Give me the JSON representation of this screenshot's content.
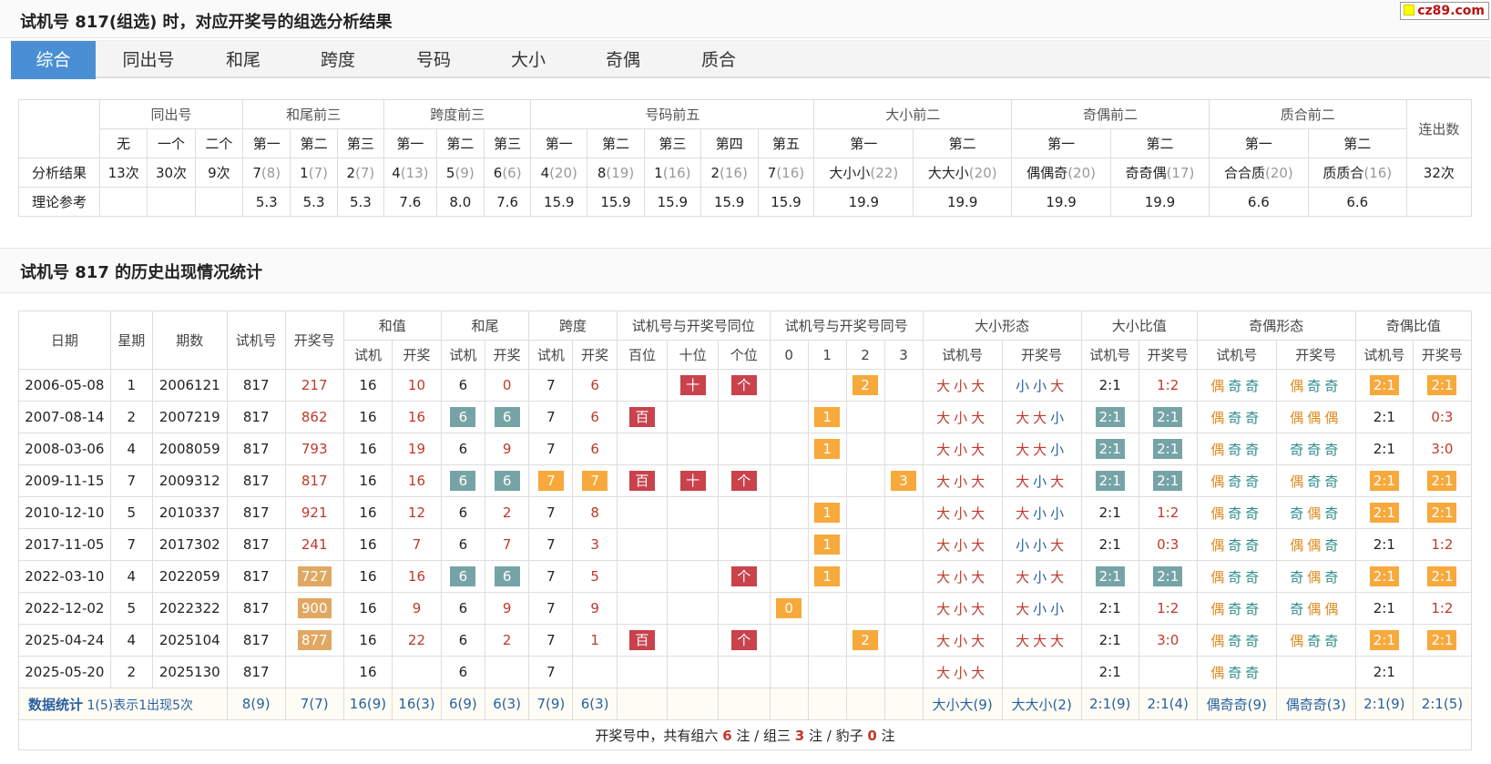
{
  "page_title": "试机号 817(组选) 时，对应开奖号的组选分析结果",
  "logo": "cz89.com",
  "tabs": [
    "综合",
    "同出号",
    "和尾",
    "跨度",
    "号码",
    "大小",
    "奇偶",
    "质合"
  ],
  "analysis": {
    "groups": [
      "同出号",
      "和尾前三",
      "跨度前三",
      "号码前五",
      "大小前二",
      "奇偶前二",
      "质合前二",
      "连出数"
    ],
    "subs": [
      "无",
      "一个",
      "二个",
      "第一",
      "第二",
      "第三",
      "第一",
      "第二",
      "第三",
      "第一",
      "第二",
      "第三",
      "第四",
      "第五",
      "第一",
      "第二",
      "第一",
      "第二",
      "第一",
      "第二"
    ],
    "row1_label": "分析结果",
    "row1": [
      [
        "13次",
        ""
      ],
      [
        "30次",
        ""
      ],
      [
        "9次",
        ""
      ],
      [
        "7",
        "(8)"
      ],
      [
        "1",
        "(7)"
      ],
      [
        "2",
        "(7)"
      ],
      [
        "4",
        "(13)"
      ],
      [
        "5",
        "(9)"
      ],
      [
        "6",
        "(6)"
      ],
      [
        "4",
        "(20)"
      ],
      [
        "8",
        "(19)"
      ],
      [
        "1",
        "(16)"
      ],
      [
        "2",
        "(16)"
      ],
      [
        "7",
        "(16)"
      ],
      [
        "大小小",
        "(22)"
      ],
      [
        "大大小",
        "(20)"
      ],
      [
        "偶偶奇",
        "(20)"
      ],
      [
        "奇奇偶",
        "(17)"
      ],
      [
        "合合质",
        "(20)"
      ],
      [
        "质质合",
        "(16)"
      ],
      [
        "32次",
        ""
      ]
    ],
    "row2_label": "理论参考",
    "row2": [
      "",
      "",
      "",
      "5.3",
      "5.3",
      "5.3",
      "7.6",
      "8.0",
      "7.6",
      "15.9",
      "15.9",
      "15.9",
      "15.9",
      "15.9",
      "19.9",
      "19.9",
      "19.9",
      "19.9",
      "6.6",
      "6.6",
      ""
    ]
  },
  "history_title": "试机号 817 的历史出现情况统计",
  "history": {
    "h1": [
      "日期",
      "星期",
      "期数",
      "试机号",
      "开奖号",
      "和值",
      "和尾",
      "跨度",
      "试机号与开奖号同位",
      "试机号与开奖号同号",
      "大小形态",
      "大小比值",
      "奇偶形态",
      "奇偶比值"
    ],
    "h2": [
      "试机",
      "开奖",
      "试机",
      "开奖",
      "试机",
      "开奖",
      "百位",
      "十位",
      "个位",
      "0",
      "1",
      "2",
      "3",
      "试机号",
      "开奖号",
      "试机号",
      "开奖号",
      "试机号",
      "开奖号",
      "试机号",
      "开奖号"
    ],
    "rows": [
      [
        "2006-05-08",
        "1",
        "2006121",
        "817",
        [
          "217",
          ""
        ],
        "16",
        "10",
        [
          "6",
          ""
        ],
        [
          "0",
          ""
        ],
        [
          "7",
          ""
        ],
        [
          "6",
          ""
        ],
        "",
        "十",
        "个",
        "",
        "",
        "2",
        "",
        "大小大",
        "小小大",
        [
          "2:1",
          ""
        ],
        [
          "1:2",
          ""
        ],
        "偶奇奇",
        "偶奇奇",
        [
          "2:1",
          "o"
        ],
        [
          "2:1",
          "o"
        ]
      ],
      [
        "2007-08-14",
        "2",
        "2007219",
        "817",
        [
          "862",
          ""
        ],
        "16",
        "16",
        [
          "6",
          "g"
        ],
        [
          "6",
          "g"
        ],
        [
          "7",
          ""
        ],
        [
          "6",
          ""
        ],
        "百",
        "",
        "",
        "",
        "1",
        "",
        "",
        "大小大",
        "大大小",
        [
          "2:1",
          "g"
        ],
        [
          "2:1",
          "g"
        ],
        "偶奇奇",
        "偶偶偶",
        [
          "2:1",
          ""
        ],
        [
          "0:3",
          ""
        ]
      ],
      [
        "2008-03-06",
        "4",
        "2008059",
        "817",
        [
          "793",
          ""
        ],
        "16",
        "19",
        [
          "6",
          ""
        ],
        [
          "9",
          ""
        ],
        [
          "7",
          ""
        ],
        [
          "6",
          ""
        ],
        "",
        "",
        "",
        "",
        "1",
        "",
        "",
        "大小大",
        "大大小",
        [
          "2:1",
          "g"
        ],
        [
          "2:1",
          "g"
        ],
        "偶奇奇",
        "奇奇奇",
        [
          "2:1",
          ""
        ],
        [
          "3:0",
          ""
        ]
      ],
      [
        "2009-11-15",
        "7",
        "2009312",
        "817",
        [
          "817",
          ""
        ],
        "16",
        "16",
        [
          "6",
          "g"
        ],
        [
          "6",
          "g"
        ],
        [
          "7",
          "o"
        ],
        [
          "7",
          "o"
        ],
        "百",
        "十",
        "个",
        "",
        "",
        "",
        "3",
        "大小大",
        "大小大",
        [
          "2:1",
          "g"
        ],
        [
          "2:1",
          "g"
        ],
        "偶奇奇",
        "偶奇奇",
        [
          "2:1",
          "o"
        ],
        [
          "2:1",
          "o"
        ]
      ],
      [
        "2010-12-10",
        "5",
        "2010337",
        "817",
        [
          "921",
          ""
        ],
        "16",
        "12",
        [
          "6",
          ""
        ],
        [
          "2",
          ""
        ],
        [
          "7",
          ""
        ],
        [
          "8",
          ""
        ],
        "",
        "",
        "",
        "",
        "1",
        "",
        "",
        "大小大",
        "大小小",
        [
          "2:1",
          ""
        ],
        [
          "1:2",
          ""
        ],
        "偶奇奇",
        "奇偶奇",
        [
          "2:1",
          "o"
        ],
        [
          "2:1",
          "o"
        ]
      ],
      [
        "2017-11-05",
        "7",
        "2017302",
        "817",
        [
          "241",
          ""
        ],
        "16",
        "7",
        [
          "6",
          ""
        ],
        [
          "7",
          ""
        ],
        [
          "7",
          ""
        ],
        [
          "3",
          ""
        ],
        "",
        "",
        "",
        "",
        "1",
        "",
        "",
        "大小大",
        "小小大",
        [
          "2:1",
          ""
        ],
        [
          "0:3",
          ""
        ],
        "偶奇奇",
        "偶偶奇",
        [
          "2:1",
          ""
        ],
        [
          "1:2",
          ""
        ]
      ],
      [
        "2022-03-10",
        "4",
        "2022059",
        "817",
        [
          "727",
          "t"
        ],
        "16",
        "16",
        [
          "6",
          "g"
        ],
        [
          "6",
          "g"
        ],
        [
          "7",
          ""
        ],
        [
          "5",
          ""
        ],
        "",
        "",
        "个",
        "",
        "1",
        "",
        "",
        "大小大",
        "大小大",
        [
          "2:1",
          "g"
        ],
        [
          "2:1",
          "g"
        ],
        "偶奇奇",
        "奇偶奇",
        [
          "2:1",
          "o"
        ],
        [
          "2:1",
          "o"
        ]
      ],
      [
        "2022-12-02",
        "5",
        "2022322",
        "817",
        [
          "900",
          "t"
        ],
        "16",
        "9",
        [
          "6",
          ""
        ],
        [
          "9",
          ""
        ],
        [
          "7",
          ""
        ],
        [
          "9",
          ""
        ],
        "",
        "",
        "",
        "0",
        "",
        "",
        "",
        "大小大",
        "大小小",
        [
          "2:1",
          ""
        ],
        [
          "1:2",
          ""
        ],
        "偶奇奇",
        "奇偶偶",
        [
          "2:1",
          ""
        ],
        [
          "1:2",
          ""
        ]
      ],
      [
        "2025-04-24",
        "4",
        "2025104",
        "817",
        [
          "877",
          "t"
        ],
        "16",
        "22",
        [
          "6",
          ""
        ],
        [
          "2",
          ""
        ],
        [
          "7",
          ""
        ],
        [
          "1",
          ""
        ],
        "百",
        "",
        "个",
        "",
        "",
        "2",
        "",
        "大小大",
        "大大大",
        [
          "2:1",
          ""
        ],
        [
          "3:0",
          ""
        ],
        "偶奇奇",
        "偶奇奇",
        [
          "2:1",
          "o"
        ],
        [
          "2:1",
          "o"
        ]
      ],
      [
        "2025-05-20",
        "2",
        "2025130",
        "817",
        [
          "",
          ""
        ],
        "16",
        "",
        [
          "6",
          ""
        ],
        [
          "",
          ""
        ],
        [
          "7",
          ""
        ],
        [
          "",
          ""
        ],
        "",
        "",
        "",
        "",
        "",
        "",
        "",
        "大小大",
        "",
        [
          "2:1",
          ""
        ],
        [
          "",
          ""
        ],
        "偶奇奇",
        "",
        [
          "2:1",
          ""
        ],
        [
          "",
          ""
        ]
      ]
    ],
    "stats_label": "数据统计",
    "stats_note": "1(5)表示1出现5次",
    "stats": [
      "8(9)",
      "7(7)",
      "16(9)",
      "16(3)",
      "6(9)",
      "6(3)",
      "7(9)",
      "6(3)",
      "",
      "",
      "",
      "",
      "",
      "",
      "",
      "大小大(9)",
      "大大小(2)",
      "2:1(9)",
      "2:1(4)",
      "偶奇奇(9)",
      "偶奇奇(3)",
      "2:1(9)",
      "2:1(5)"
    ],
    "foot": {
      "a": "开奖号中，共有组六",
      "n1": "6",
      "b": "注 / 组三",
      "n2": "3",
      "c": "注 / 豹子",
      "n3": "0",
      "d": "注"
    }
  }
}
